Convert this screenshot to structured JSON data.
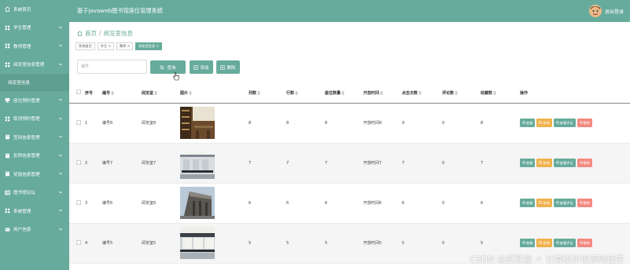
{
  "colors": {
    "accent": "#66ab9b",
    "accent_dark": "#5f9f90",
    "edit": "#f0b24c",
    "delete": "#f4897f"
  },
  "header": {
    "app_title": "基于javaweb图书馆座位管理系统",
    "logout": "退出登录"
  },
  "sidebar": {
    "items": [
      {
        "icon": "home-icon",
        "label": "系统首页",
        "chevron": false
      },
      {
        "icon": "grid-icon",
        "label": "学生管理",
        "chevron": true
      },
      {
        "icon": "grid-icon",
        "label": "教师管理",
        "chevron": true
      },
      {
        "icon": "grid-icon",
        "label": "阅览室信息管理",
        "chevron": true
      },
      {
        "icon": "",
        "label": "阅览室信息",
        "chevron": false,
        "sub": true
      },
      {
        "icon": "monitor-icon",
        "label": "座位预约管理",
        "chevron": true
      },
      {
        "icon": "grid-icon",
        "label": "取消预约管理",
        "chevron": true
      },
      {
        "icon": "book-icon",
        "label": "签到信息管理",
        "chevron": true
      },
      {
        "icon": "book-icon",
        "label": "扣除信息管理",
        "chevron": true
      },
      {
        "icon": "book-icon",
        "label": "奖励信息管理",
        "chevron": true
      },
      {
        "icon": "table-icon",
        "label": "图书馆论坛",
        "chevron": true
      },
      {
        "icon": "grid-icon",
        "label": "系统管理",
        "chevron": true
      },
      {
        "icon": "card-icon",
        "label": "用户信息",
        "chevron": true
      }
    ]
  },
  "breadcrumb": {
    "home": "首页",
    "separator": "/",
    "current": "阅览室信息"
  },
  "tabs": [
    "系统首页",
    "学生 ×",
    "教师 ×",
    "阅览室信息 ×"
  ],
  "search": {
    "placeholder": "编号"
  },
  "toolbar": {
    "query": "查询",
    "add": "添加",
    "delete": "删除"
  },
  "table": {
    "columns": [
      "序号",
      "编号",
      "阅览室",
      "图片",
      "列数",
      "行数",
      "座位数量",
      "开放时间",
      "点击次数",
      "评论数",
      "收藏数",
      "操作"
    ],
    "rows": [
      {
        "seq": "1",
        "code": "编号8",
        "room": "阅览室8",
        "cols": "8",
        "rows": "8",
        "seats": "8",
        "open": "开放时间8",
        "clicks": "9",
        "comments": "0",
        "favs": "8"
      },
      {
        "seq": "2",
        "code": "编号7",
        "room": "阅览室7",
        "cols": "7",
        "rows": "7",
        "seats": "7",
        "open": "开放时间7",
        "clicks": "7",
        "comments": "0",
        "favs": "7"
      },
      {
        "seq": "3",
        "code": "编号6",
        "room": "阅览室6",
        "cols": "6",
        "rows": "6",
        "seats": "6",
        "open": "开放时间6",
        "clicks": "6",
        "comments": "0",
        "favs": "6"
      },
      {
        "seq": "4",
        "code": "编号5",
        "room": "阅览室5",
        "cols": "5",
        "rows": "5",
        "seats": "5",
        "open": "开放时间5",
        "clicks": "5",
        "comments": "0",
        "favs": "5"
      }
    ],
    "actions": {
      "view": "查看",
      "edit": "修改",
      "comments": "查看评论",
      "delete": "删除"
    }
  },
  "watermark": "CSDN @苏苏酱 〃 计算机毕设源码程序"
}
